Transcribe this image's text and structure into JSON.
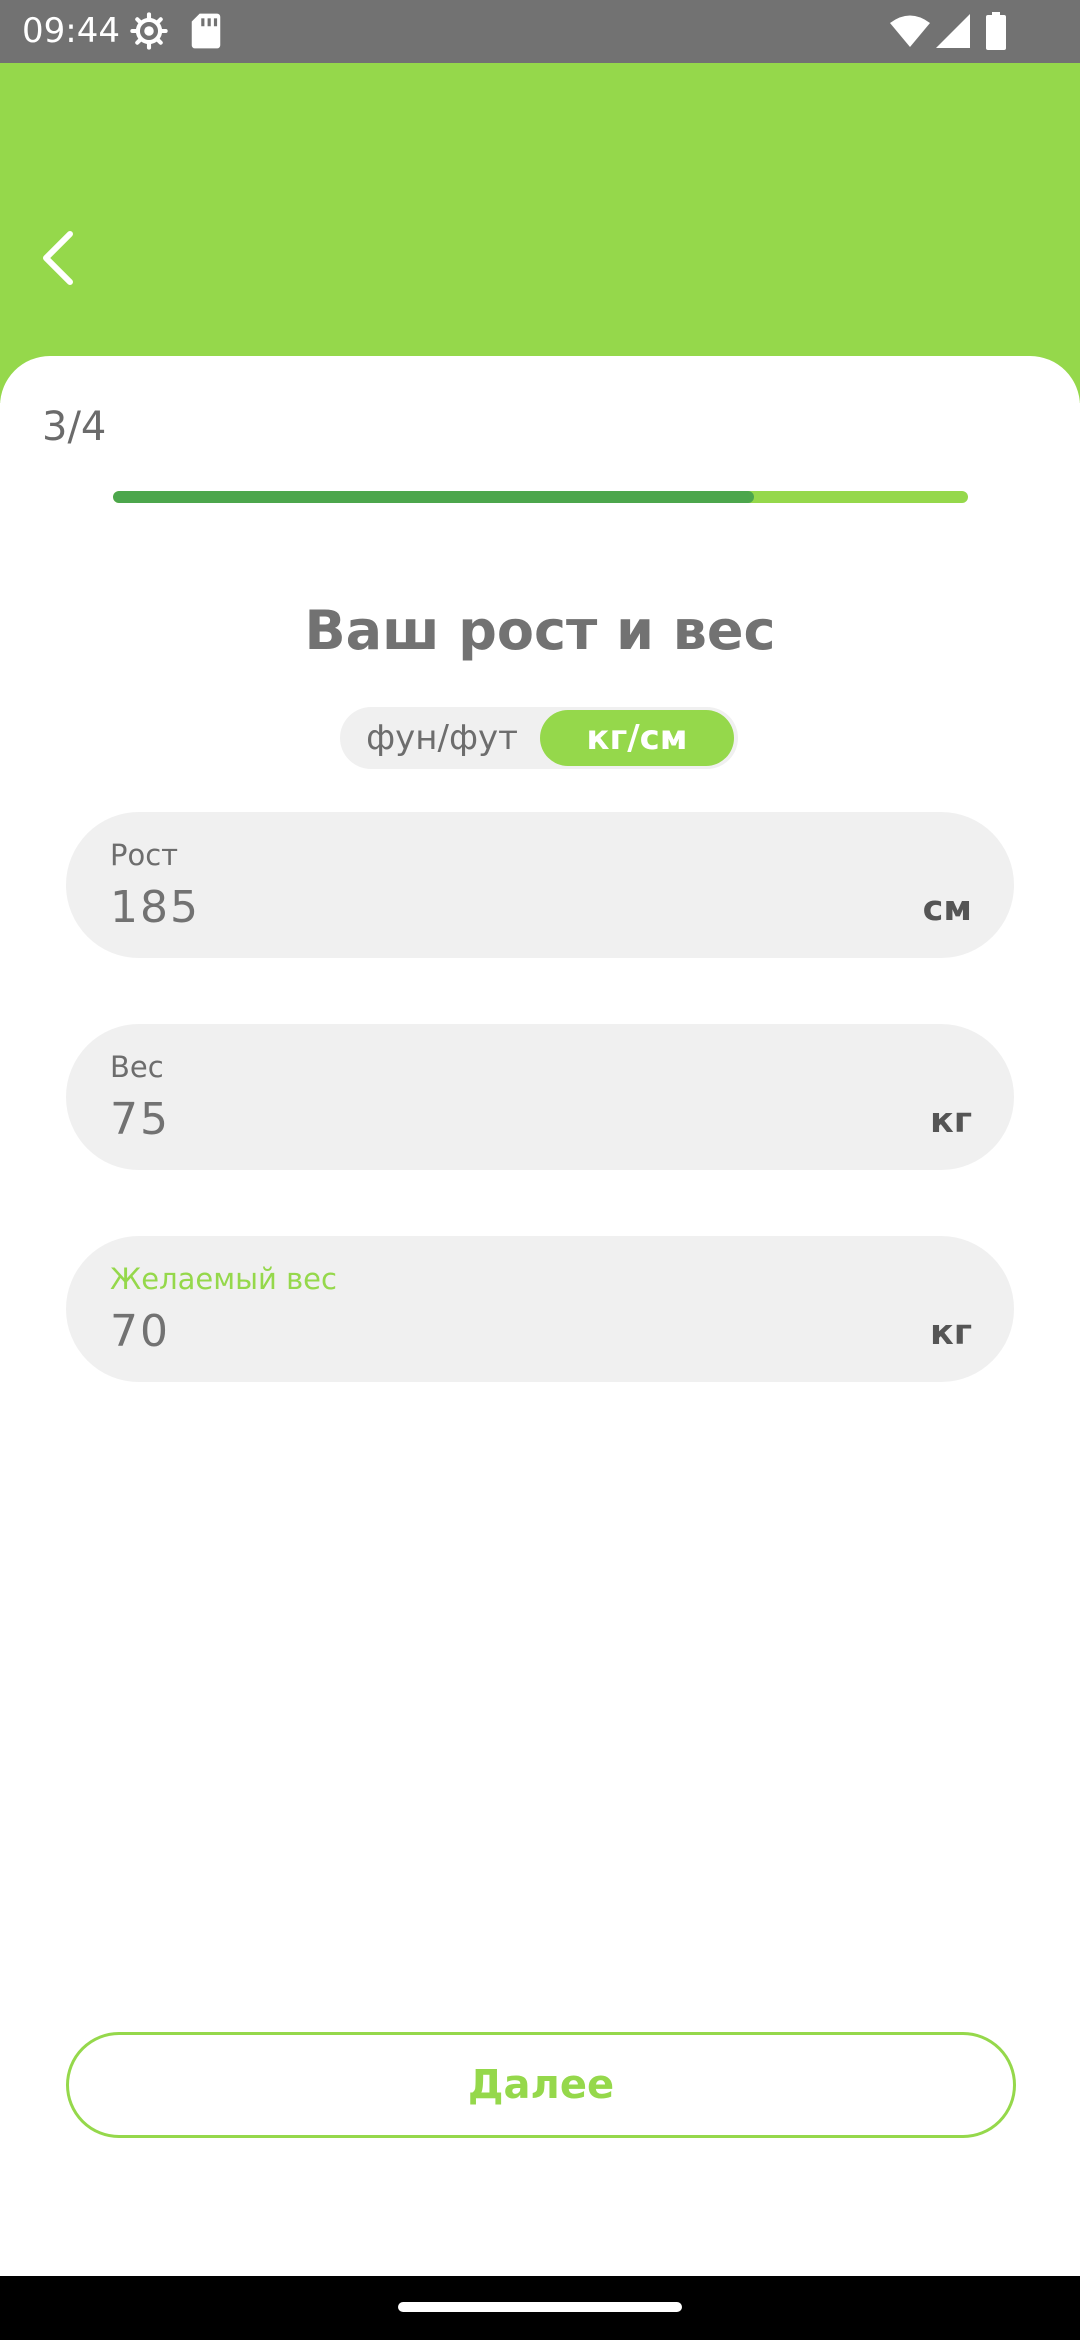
{
  "status_bar": {
    "time": "09:44",
    "icons": [
      "settings-icon",
      "sd-card-icon",
      "wifi-icon",
      "signal-icon",
      "battery-icon"
    ]
  },
  "header": {
    "back_icon": "chevron-left-icon",
    "color": "#95d84b"
  },
  "progress": {
    "step_text": "3/4",
    "fraction": 0.75,
    "fill_color": "#4ca64c",
    "track_color": "#95d84b"
  },
  "title": "Ваш рост и вес",
  "unit_toggle": {
    "options": [
      "фун/фут",
      "кг/см"
    ],
    "selected": "кг/см"
  },
  "fields": [
    {
      "label": "Рост",
      "value": "185",
      "unit": "см"
    },
    {
      "label": "Вес",
      "value": "75",
      "unit": "кг"
    },
    {
      "label": "Желаемый вес",
      "value": "70",
      "unit": "кг"
    }
  ],
  "next_button": {
    "label": "Далее"
  },
  "colors": {
    "accent": "#95d84b",
    "text_gray": "#727272",
    "field_bg": "#f0f0f0",
    "status_bar": "#727272"
  }
}
